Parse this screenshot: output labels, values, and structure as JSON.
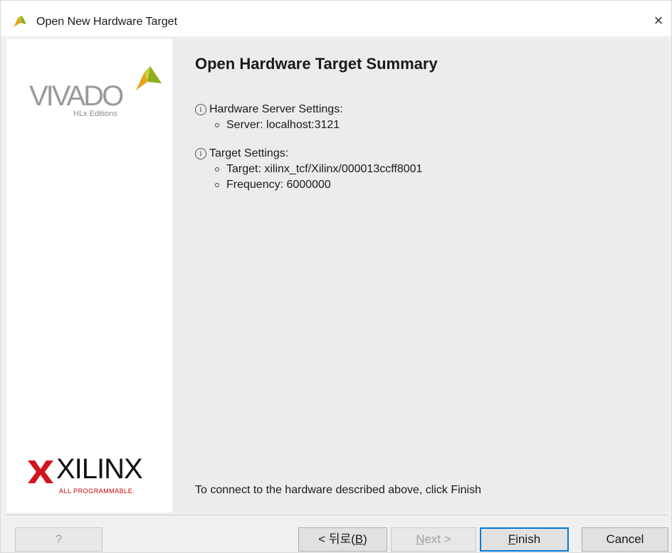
{
  "window": {
    "title": "Open New Hardware Target",
    "close_glyph": "×",
    "accent_color": "#0078d7"
  },
  "sidebar": {
    "vivado": {
      "wordmark": "VIVADO",
      "edition": "HLx Editions"
    },
    "xilinx": {
      "wordmark": "XILINX",
      "tagline": "ALL PROGRAMMABLE."
    }
  },
  "main": {
    "heading": "Open Hardware Target Summary",
    "sections": [
      {
        "title": "Hardware Server Settings:",
        "items": [
          "Server: localhost:3121"
        ]
      },
      {
        "title": "Target Settings:",
        "items": [
          "Target: xilinx_tcf/Xilinx/000013ccff8001",
          "Frequency: 6000000"
        ]
      }
    ],
    "info_glyph": "i",
    "footer_note": "To connect to the hardware described above, click Finish"
  },
  "buttons": {
    "help": "?",
    "back_prefix": "< ",
    "back_label": "뒤로(",
    "back_mnemonic": "B",
    "back_suffix": ")",
    "next_mnemonic": "N",
    "next_rest": "ext >",
    "finish_mnemonic": "F",
    "finish_rest": "inish",
    "cancel": "Cancel"
  }
}
